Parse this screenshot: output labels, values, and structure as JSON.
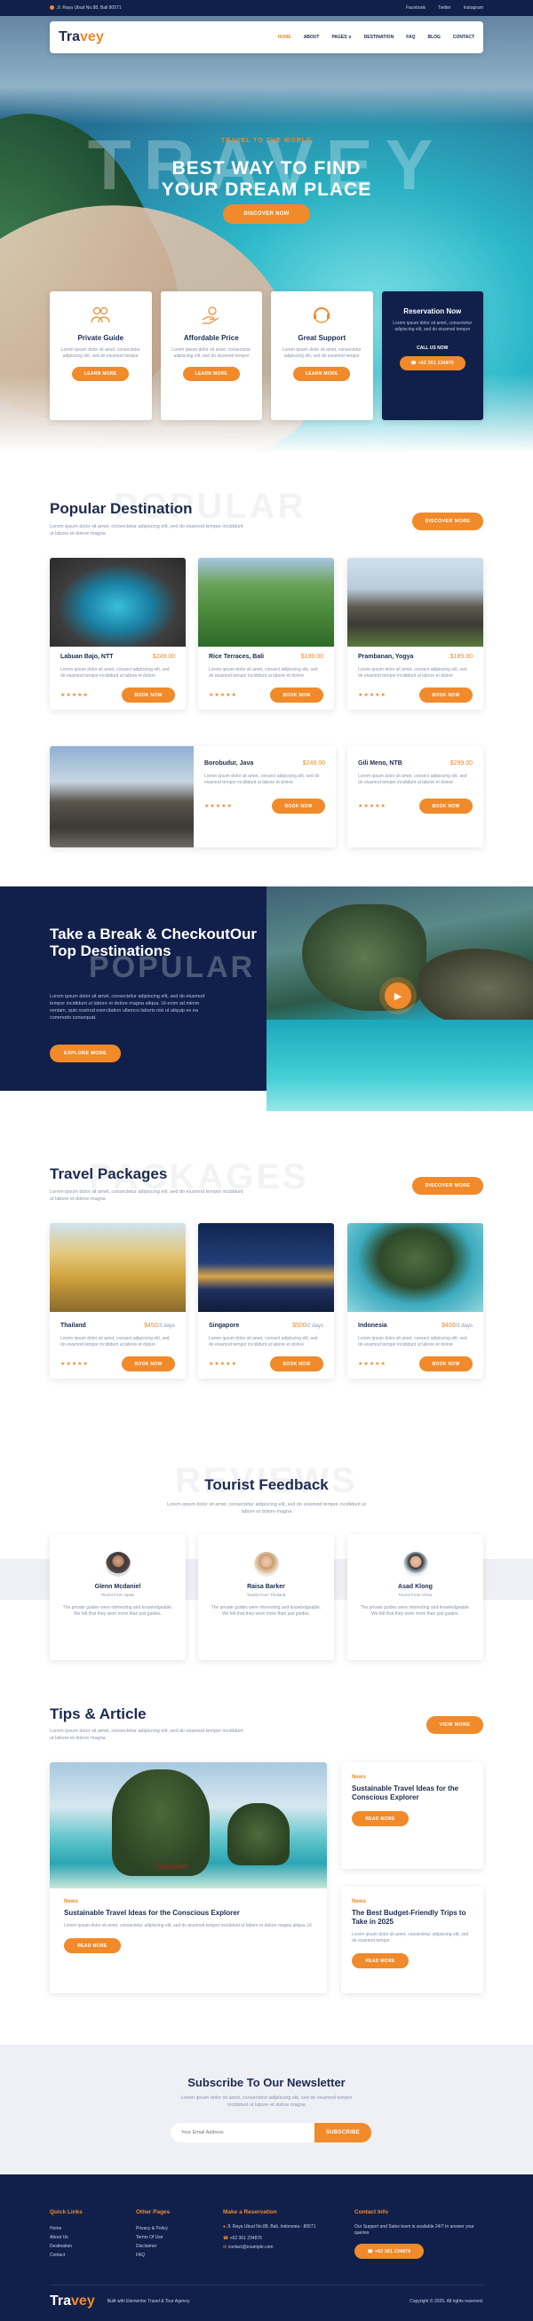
{
  "topbar": {
    "address": "Jl. Raya Ubud No.88, Bali 80571",
    "links": [
      "Facebook",
      "Twitter",
      "Instagram"
    ]
  },
  "brand": {
    "logo_main": "Tra",
    "logo_accent": "vey"
  },
  "nav": {
    "items": [
      "HOME",
      "ABOUT",
      "PAGES ∨",
      "DESTINATION",
      "FAQ",
      "BLOG",
      "CONTACT"
    ]
  },
  "hero": {
    "watermark": "TRAVEY",
    "eyebrow": "TRAVEL TO THE WORLD",
    "title_line1": "BEST WAY TO FIND",
    "title_line2": "YOUR DREAM PLACE",
    "button": "DISCOVER NOW"
  },
  "features": [
    {
      "icon": "users-icon",
      "glyph": "⚇",
      "title": "Private Guide",
      "text": "Lorem ipsum dolor sit amet, consectetur adipiscing elit, sed do eiusmod tempor",
      "button": "LEARN MORE"
    },
    {
      "icon": "hand-coin-icon",
      "glyph": "✋",
      "title": "Affordable Price",
      "text": "Lorem ipsum dolor sit amet, consectetur adipiscing elit, sed do eiusmod tempor",
      "button": "LEARN MORE"
    },
    {
      "icon": "support-icon",
      "glyph": "☎",
      "title": "Great Support",
      "text": "Lorem ipsum dolor sit amet, consectetur adipiscing elit, sed do eiusmod tempor",
      "button": "LEARN MORE"
    }
  ],
  "reservation": {
    "title": "Reservation Now",
    "text": "Lorem ipsum dolor sit amet, consectetur adipiscing elit, sed do eiusmod tempor",
    "call_label": "CALL US NOW",
    "phone": "+62 361 234876"
  },
  "popular": {
    "ghost": "POPULAR",
    "title": "Popular Destination",
    "desc": "Lorem ipsum dolor sit amet, consectetur adipiscing elit, sed do eiusmod tempor incididunt ut labore et dolore magna",
    "button": "DISCOVER MORE",
    "cards": [
      {
        "name": "Labuan Bajo, NTT",
        "price": "$249.00",
        "desc": "Lorem ipsum dolor sit amet, consect adipiscing elit, sed do eiusmod tempor incididunt ut labore et dolore",
        "stars": "★★★★★",
        "button": "BOOK NOW"
      },
      {
        "name": "Rice Terraces, Bali",
        "price": "$199.00",
        "desc": "Lorem ipsum dolor sit amet, consect adipiscing elit, sed do eiusmod tempor incididunt ut labore et dolore",
        "stars": "★★★★★",
        "button": "BOOK NOW"
      },
      {
        "name": "Prambanan, Yogya",
        "price": "$189.00",
        "desc": "Lorem ipsum dolor sit amet, consect adipiscing elit, sed do eiusmod tempor incididunt ut labore et dolore",
        "stars": "★★★★★",
        "button": "BOOK NOW"
      },
      {
        "name": "Borobudur, Java",
        "price": "$249.00",
        "desc": "Lorem ipsum dolor sit amet, consect adipiscing elit, sed do eiusmod tempor incididunt ut labore et dolore",
        "stars": "★★★★★",
        "button": "BOOK NOW"
      },
      {
        "name": "Gili Meno, NTB",
        "price": "$299.00",
        "desc": "Lorem ipsum dolor sit amet, consect adipiscing elit, sed do eiusmod tempor incididunt ut labore et dolore",
        "stars": "★★★★★",
        "button": "BOOK NOW"
      }
    ]
  },
  "promo": {
    "ghost": "POPULAR",
    "title": "Take a Break & CheckoutOur Top Destinations",
    "desc": "Lorem ipsum dolor sit amet, consectetur adipiscing elit, sed do eiusmod tempor incididunt ut labore et dolore magna aliqua. Ut enim ad minim veniam, quis nostrud exercitation ullamco laboris nisi ut aliquip ex ea commodo consequat.",
    "button": "EXPLORE MORE"
  },
  "packages": {
    "ghost": "PACKAGES",
    "title": "Travel Packages",
    "desc": "Lorem ipsum dolor sit amet, consectetur adipiscing elit, sed do eiusmod tempor incididunt ut labore et dolore magna",
    "button": "DISCOVER MORE",
    "cards": [
      {
        "name": "Thailand",
        "price": "$450",
        "duration": "/3 days",
        "desc": "Lorem ipsum dolor sit amet, consect adipiscing elit, sed do eiusmod tempor incididunt ut labore et dolore",
        "stars": "★★★★★",
        "button": "BOOK NOW"
      },
      {
        "name": "Singapore",
        "price": "$500",
        "duration": "/2 days",
        "desc": "Lorem ipsum dolor sit amet, consect adipiscing elit, sed do eiusmod tempor incididunt ut labore et dolore",
        "stars": "★★★★★",
        "button": "BOOK NOW"
      },
      {
        "name": "Indonesia",
        "price": "$400",
        "duration": "/3 days",
        "desc": "Lorem ipsum dolor sit amet, consect adipiscing elit, sed do eiusmod tempor incididunt ut labore et dolore",
        "stars": "★★★★★",
        "button": "BOOK NOW"
      }
    ]
  },
  "feedback": {
    "ghost": "REVIEWS",
    "title": "Tourist Feedback",
    "desc": "Lorem ipsum dolor sit amet, consectetur adipiscing elit, sed do eiusmod tempor incididunt ut labore et dolore magna",
    "items": [
      {
        "name": "Glenn Mcdaniel",
        "role": "Tourist From Spain",
        "text": "The private guides were interesting and knowledgeable. We felt that they were more than just guides."
      },
      {
        "name": "Raisa Barker",
        "role": "Tourist From Thailand",
        "text": "The private guides were interesting and knowledgeable. We felt that they were more than just guides."
      },
      {
        "name": "Asad Klong",
        "role": "Tourist From China",
        "text": "The private guides were interesting and knowledgeable. We felt that they were more than just guides."
      }
    ]
  },
  "articles": {
    "title": "Tips & Article",
    "desc": "Lorem ipsum dolor sit amet, consectetur adipiscing elit, sed do eiusmod tempor incididunt ut labore et dolore magna",
    "button": "VIEW MORE",
    "big": {
      "tag": "News",
      "title": "Sustainable Travel Ideas for the Conscious Explorer",
      "desc": "Lorem ipsum dolor sit amet, consectetur adipiscing elit, sed do eiusmod tempor incididunt ut labore et dolore magna aliqua. Ut",
      "button": "READ MORE"
    },
    "small": [
      {
        "tag": "News",
        "title": "Sustainable Travel Ideas for the Conscious Explorer",
        "button": "READ MORE"
      },
      {
        "tag": "News",
        "title": "The Best Budget-Friendly Trips to Take in 2025",
        "desc": "Lorem ipsum dolor sit amet, consectetur adipiscing elit, sed do eiusmod tempor",
        "button": "READ MORE"
      }
    ]
  },
  "newsletter": {
    "title": "Subscribe To Our Newsletter",
    "desc": "Lorem ipsum dolor sit amet, consectetur adipiscing elit, sed do eiusmod tempor incididunt ut labore et dolore magna",
    "placeholder": "Your Email Address",
    "button": "SUBSCRIBE"
  },
  "footer": {
    "quick_links": {
      "title": "Quick Links",
      "items": [
        "Home",
        "About Us",
        "Destination",
        "Contact"
      ]
    },
    "other_pages": {
      "title": "Other Pages",
      "items": [
        "Privacy & Policy",
        "Terms Of Use",
        "Disclaimer",
        "FAQ"
      ]
    },
    "reservation": {
      "title": "Make a Reservation",
      "address": "Jl. Raya Ubud No.88, Bali, Indonesia - 80571",
      "phone": "+62 361 234876",
      "email": "contact@example.com"
    },
    "contact": {
      "title": "Contact Info",
      "text": "Our Support and Sales team is available 24/7 to answer your queries",
      "phone": "+62 361 234876"
    },
    "bottom_logo_main": "Tra",
    "bottom_logo_accent": "vey",
    "built_with": "Built with Elementor Travel & Tour Agency",
    "copyright": "Copyright © 2025. All rights reserved."
  },
  "colors": {
    "accent": "#f08a2a",
    "navy": "#11204a",
    "text": "#1d2b4f",
    "muted": "#8a93a8"
  }
}
